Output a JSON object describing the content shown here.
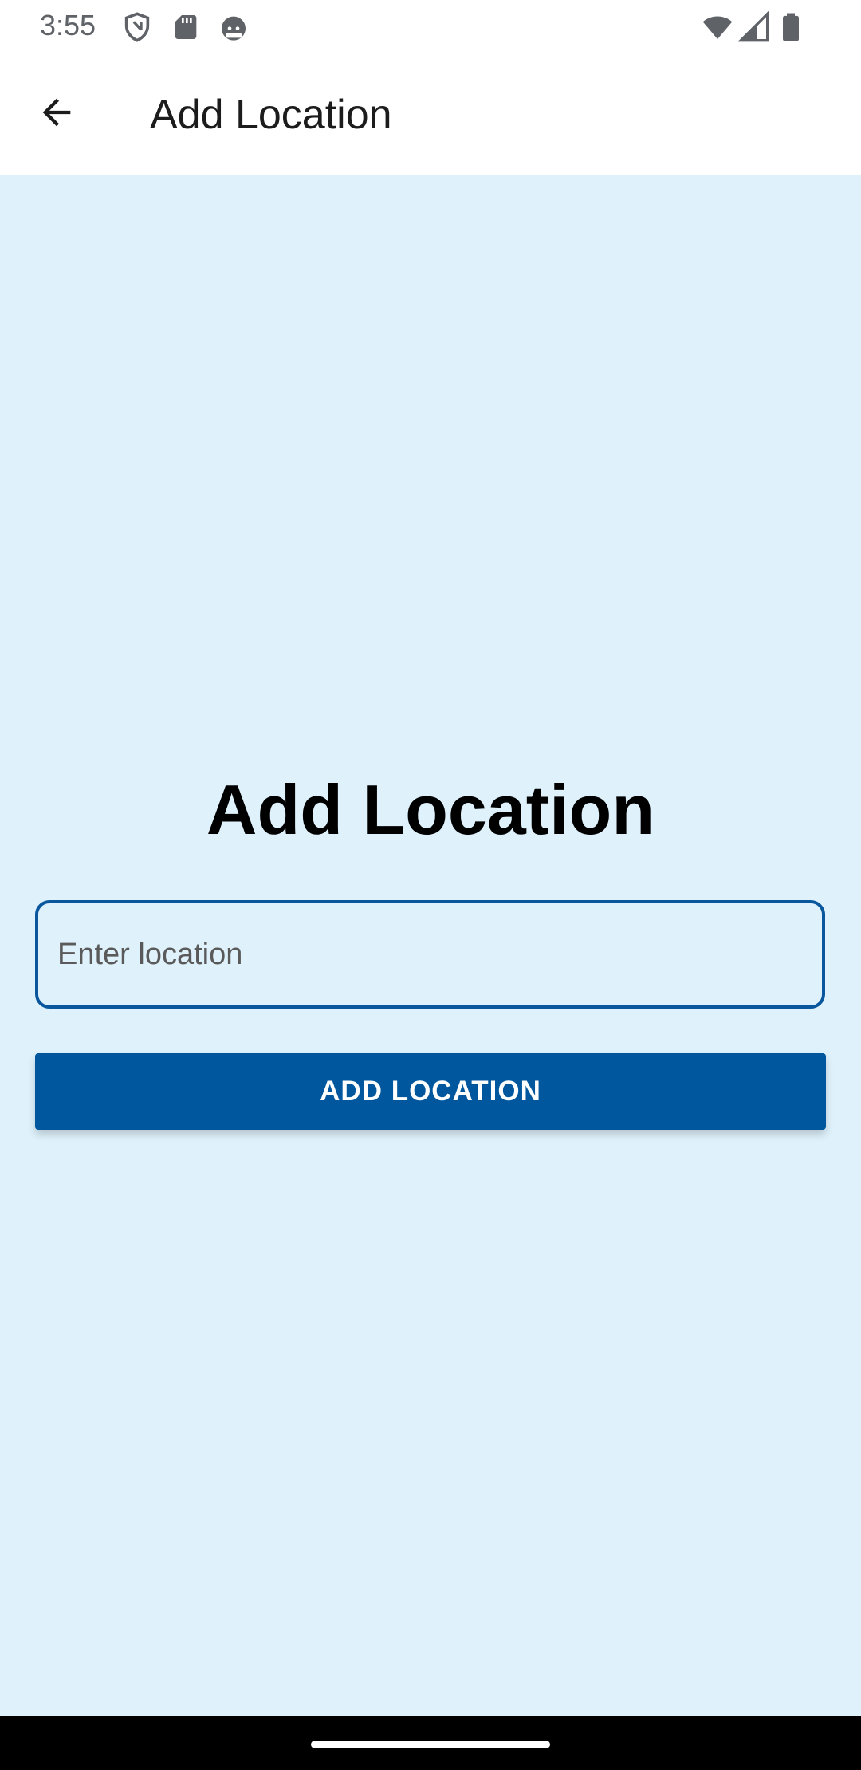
{
  "status_bar": {
    "time": "3:55",
    "icons": [
      "shield-icon",
      "sd-card-icon",
      "android-icon",
      "wifi-icon",
      "signal-icon",
      "battery-icon"
    ]
  },
  "app_bar": {
    "back_icon": "arrow-back-icon",
    "title": "Add Location"
  },
  "main": {
    "heading": "Add Location",
    "input": {
      "value": "",
      "placeholder": "Enter location"
    },
    "add_button_label": "ADD LOCATION"
  },
  "colors": {
    "background": "#dff2fc",
    "accent": "#00579e",
    "input_border": "#0b579e",
    "app_bar": "#ffffff"
  }
}
